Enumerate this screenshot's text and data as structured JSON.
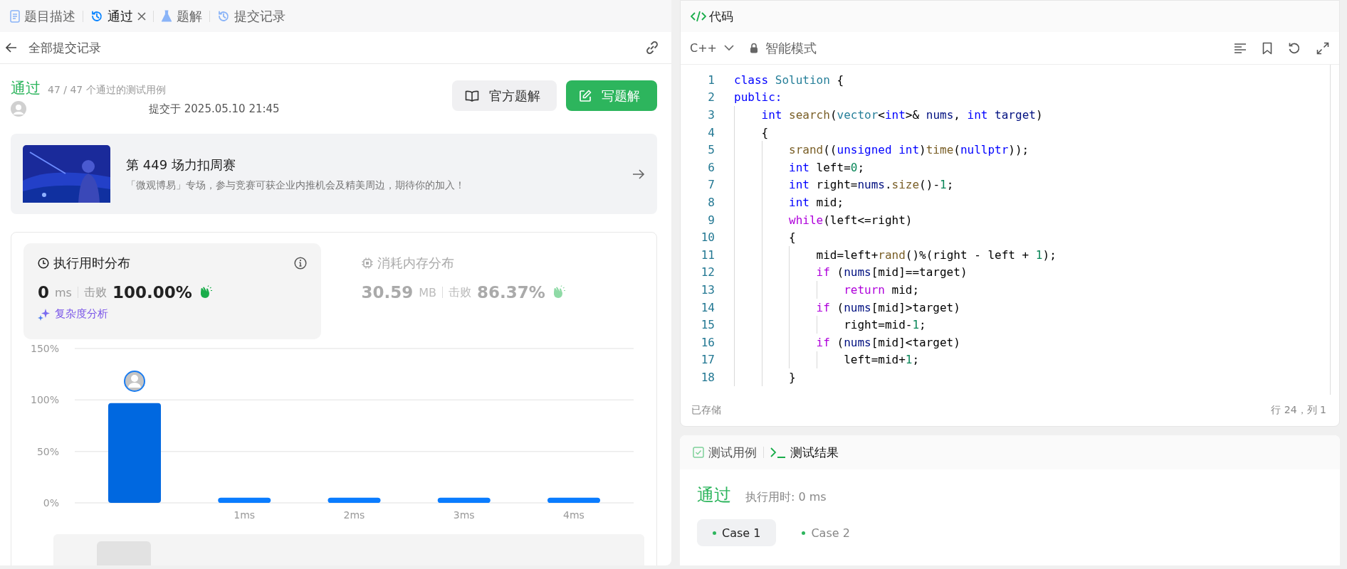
{
  "left_tabs": [
    {
      "label": "题目描述",
      "selected": false,
      "closable": false
    },
    {
      "label": "通过",
      "selected": true,
      "closable": true
    },
    {
      "label": "题解",
      "selected": false,
      "closable": false
    },
    {
      "label": "提交记录",
      "selected": false,
      "closable": false
    }
  ],
  "header": {
    "title": "全部提交记录"
  },
  "submission": {
    "status": "通过",
    "passed_cases": "47 / 47 个通过的测试用例",
    "submitted_at": "提交于 2025.05.10 21:45",
    "buttons": [
      {
        "label": "官方题解",
        "kind": "secondary"
      },
      {
        "label": "写题解",
        "kind": "primary"
      }
    ]
  },
  "banner": {
    "title": "第 449 场力扣周赛",
    "subtitle": "「微观博易」专场，参与竞赛可获企业内推机会及精美周边，期待你的加入！"
  },
  "stats": [
    {
      "title": "执行用时分布",
      "value": "0",
      "unit": "ms",
      "beat_label": "击败",
      "beat": "100.00%",
      "selected": true,
      "link": "复杂度分析"
    },
    {
      "title": "消耗内存分布",
      "value": "30.59",
      "unit": "MB",
      "beat_label": "击败",
      "beat": "86.37%",
      "selected": false
    }
  ],
  "chart_data": {
    "type": "bar",
    "categories": [
      null,
      "1ms",
      "2ms",
      "3ms",
      "4ms"
    ],
    "values": [
      97,
      5,
      5,
      5,
      5
    ],
    "ylim": [
      0,
      150
    ],
    "yticks": [
      {
        "value": 0,
        "label": "0%"
      },
      {
        "value": 50,
        "label": "50%"
      },
      {
        "value": 100,
        "label": "100%"
      },
      {
        "value": 150,
        "label": "150%"
      }
    ]
  },
  "editor": {
    "title": "代码",
    "language": "C++",
    "mode": "智能模式",
    "lines": [
      {
        "number": "1",
        "tokens": [
          {
            "text": "class",
            "kind": "kw"
          },
          {
            "text": " Solution",
            "kind": "type"
          },
          {
            "text": " {",
            "kind": "plain"
          }
        ]
      },
      {
        "number": "2",
        "tokens": [
          {
            "text": "public:",
            "kind": "kw"
          }
        ]
      },
      {
        "number": "3",
        "tokens": [
          {
            "text": "    int",
            "kind": "kw"
          },
          {
            "text": " search",
            "kind": "fn"
          },
          {
            "text": "(",
            "kind": "plain"
          },
          {
            "text": "vector",
            "kind": "type"
          },
          {
            "text": "<",
            "kind": "plain"
          },
          {
            "text": "int",
            "kind": "kw"
          },
          {
            "text": ">& ",
            "kind": "plain"
          },
          {
            "text": "nums",
            "kind": "var"
          },
          {
            "text": ", ",
            "kind": "plain"
          },
          {
            "text": "int",
            "kind": "kw"
          },
          {
            "text": " target",
            "kind": "var"
          },
          {
            "text": ")",
            "kind": "plain"
          }
        ]
      },
      {
        "number": "4",
        "tokens": [
          {
            "text": "    {",
            "kind": "plain"
          }
        ]
      },
      {
        "number": "5",
        "tokens": [
          {
            "text": "        srand",
            "kind": "fn"
          },
          {
            "text": "((",
            "kind": "plain"
          },
          {
            "text": "unsigned int",
            "kind": "kw"
          },
          {
            "text": ")",
            "kind": "plain"
          },
          {
            "text": "time",
            "kind": "fn"
          },
          {
            "text": "(",
            "kind": "plain"
          },
          {
            "text": "nullptr",
            "kind": "kw"
          },
          {
            "text": "));",
            "kind": "plain"
          }
        ]
      },
      {
        "number": "6",
        "tokens": [
          {
            "text": "        int",
            "kind": "kw"
          },
          {
            "text": " left=",
            "kind": "plain"
          },
          {
            "text": "0",
            "kind": "num"
          },
          {
            "text": ";",
            "kind": "plain"
          }
        ]
      },
      {
        "number": "7",
        "tokens": [
          {
            "text": "        int",
            "kind": "kw"
          },
          {
            "text": " right=",
            "kind": "plain"
          },
          {
            "text": "nums",
            "kind": "var"
          },
          {
            "text": ".",
            "kind": "plain"
          },
          {
            "text": "size",
            "kind": "fn"
          },
          {
            "text": "()-",
            "kind": "plain"
          },
          {
            "text": "1",
            "kind": "num"
          },
          {
            "text": ";",
            "kind": "plain"
          }
        ]
      },
      {
        "number": "8",
        "tokens": [
          {
            "text": "        int",
            "kind": "kw"
          },
          {
            "text": " mid;",
            "kind": "plain"
          }
        ]
      },
      {
        "number": "9",
        "tokens": [
          {
            "text": "        while",
            "kind": "ctl"
          },
          {
            "text": "(left<=right)",
            "kind": "plain"
          }
        ]
      },
      {
        "number": "10",
        "tokens": [
          {
            "text": "        {",
            "kind": "plain"
          }
        ]
      },
      {
        "number": "11",
        "tokens": [
          {
            "text": "            mid=left+",
            "kind": "plain"
          },
          {
            "text": "rand",
            "kind": "fn"
          },
          {
            "text": "()%(right - left + ",
            "kind": "plain"
          },
          {
            "text": "1",
            "kind": "num"
          },
          {
            "text": ");",
            "kind": "plain"
          }
        ]
      },
      {
        "number": "12",
        "tokens": [
          {
            "text": "            if",
            "kind": "ctl"
          },
          {
            "text": " (",
            "kind": "plain"
          },
          {
            "text": "nums",
            "kind": "var"
          },
          {
            "text": "[mid]==target)",
            "kind": "plain"
          }
        ]
      },
      {
        "number": "13",
        "tokens": [
          {
            "text": "                return",
            "kind": "ctl"
          },
          {
            "text": " mid;",
            "kind": "plain"
          }
        ]
      },
      {
        "number": "14",
        "tokens": [
          {
            "text": "            if",
            "kind": "ctl"
          },
          {
            "text": " (",
            "kind": "plain"
          },
          {
            "text": "nums",
            "kind": "var"
          },
          {
            "text": "[mid]>target)",
            "kind": "plain"
          }
        ]
      },
      {
        "number": "15",
        "tokens": [
          {
            "text": "                right=mid-",
            "kind": "plain"
          },
          {
            "text": "1",
            "kind": "num"
          },
          {
            "text": ";",
            "kind": "plain"
          }
        ]
      },
      {
        "number": "16",
        "tokens": [
          {
            "text": "            if",
            "kind": "ctl"
          },
          {
            "text": " (",
            "kind": "plain"
          },
          {
            "text": "nums",
            "kind": "var"
          },
          {
            "text": "[mid]<target)",
            "kind": "plain"
          }
        ]
      },
      {
        "number": "17",
        "tokens": [
          {
            "text": "                left=mid+",
            "kind": "plain"
          },
          {
            "text": "1",
            "kind": "num"
          },
          {
            "text": ";",
            "kind": "plain"
          }
        ]
      },
      {
        "number": "18",
        "tokens": [
          {
            "text": "        }",
            "kind": "plain"
          }
        ]
      }
    ],
    "saved": "已存储",
    "cursor": "行 24，列 1"
  },
  "console": {
    "tabs": [
      {
        "label": "测试用例",
        "selected": false
      },
      {
        "label": "测试结果",
        "selected": true
      }
    ],
    "status": "通过",
    "runtime": "执行用时: 0 ms",
    "cases": [
      {
        "label": "Case 1",
        "selected": true,
        "passed": true
      },
      {
        "label": "Case 2",
        "selected": false,
        "passed": true
      }
    ]
  }
}
